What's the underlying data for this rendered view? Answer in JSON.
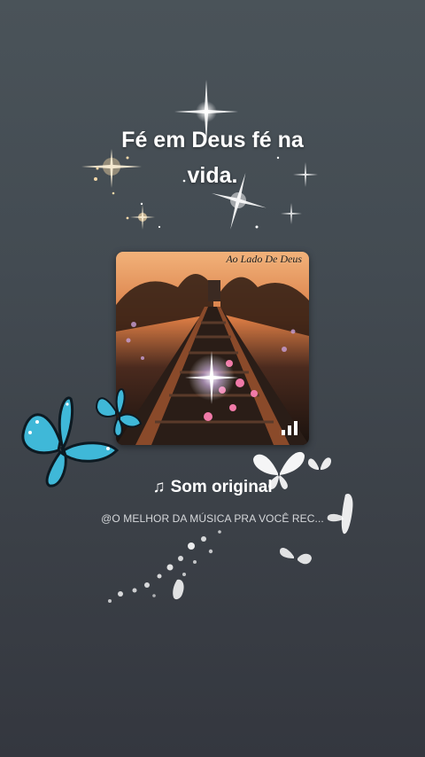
{
  "title": {
    "line1": "Fé em Deus fé na",
    "line2": "vida."
  },
  "cover": {
    "label": "Ao Lado De Deus",
    "playing_indicator": "equalizer-bars-icon"
  },
  "sound": {
    "note_icon": "♫",
    "name": "Som original",
    "author": "@O MELHOR DA MÚSICA PRA VOCÊ REC..."
  },
  "colors": {
    "background_top": "#4a5359",
    "background_bottom": "#34373f",
    "text": "#ffffff",
    "subtext": "#d6d8db"
  },
  "decorations": [
    "sparkle-icon",
    "blue-butterfly-icon",
    "white-butterfly-icon"
  ]
}
